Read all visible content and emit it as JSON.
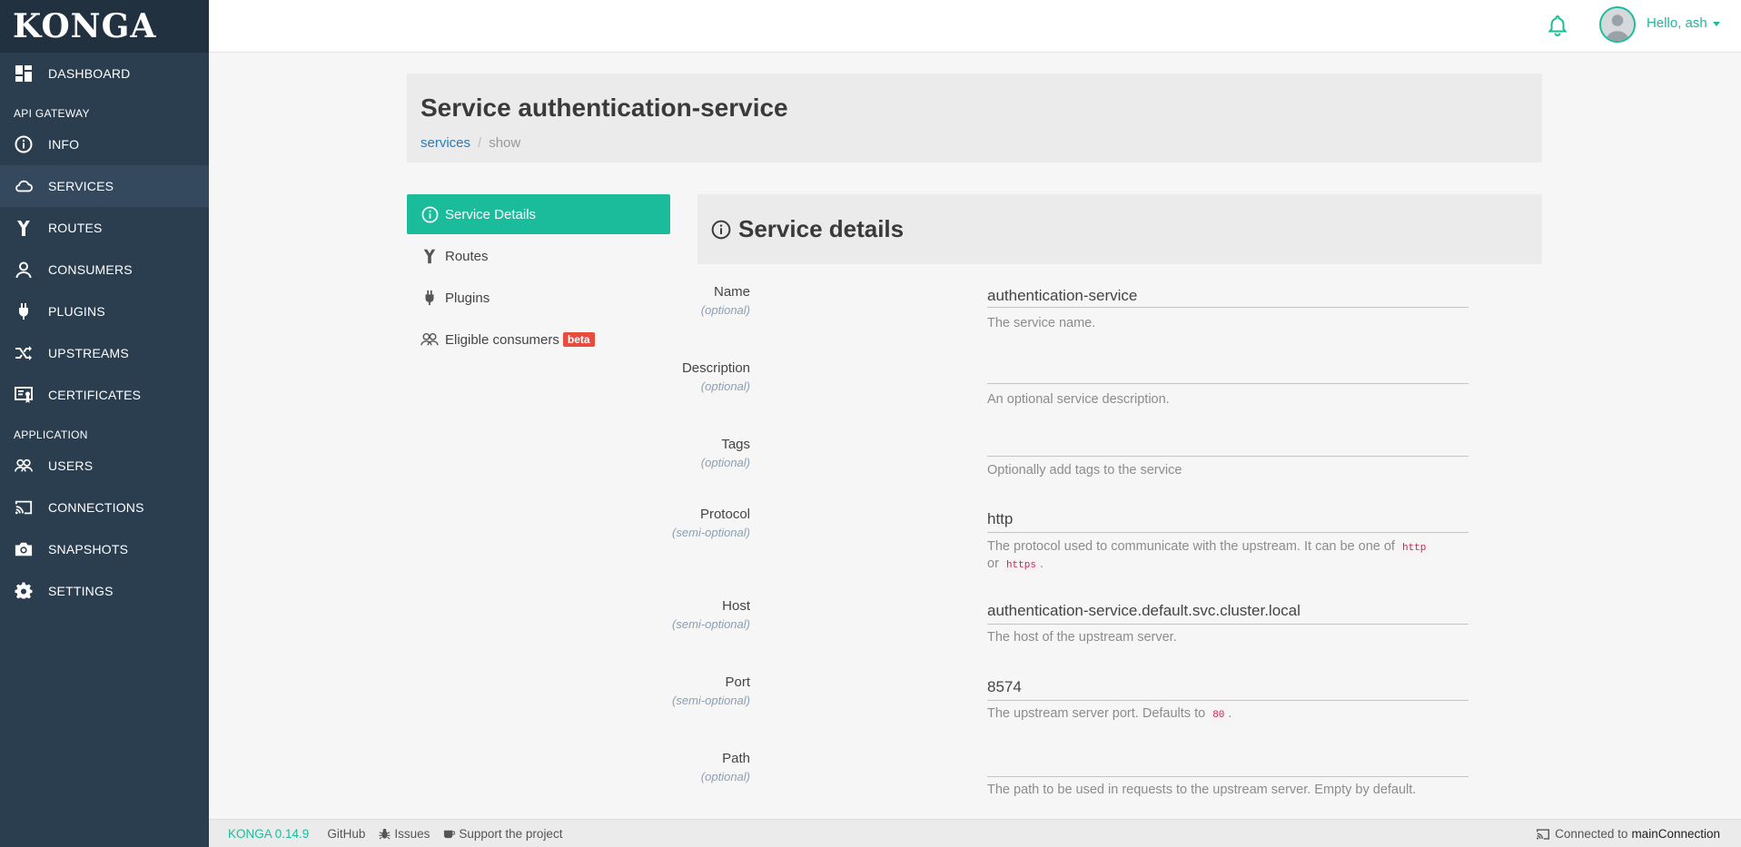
{
  "sidebar": {
    "logo": "KONGA",
    "sections": {
      "api_gateway": "API GATEWAY",
      "application": "APPLICATION"
    },
    "items": {
      "dashboard": "DASHBOARD",
      "info": "INFO",
      "services": "SERVICES",
      "routes": "ROUTES",
      "consumers": "CONSUMERS",
      "plugins": "PLUGINS",
      "upstreams": "UPSTREAMS",
      "certificates": "CERTIFICATES",
      "users": "USERS",
      "connections": "CONNECTIONS",
      "snapshots": "SNAPSHOTS",
      "settings": "SETTINGS"
    },
    "active_item": "services"
  },
  "topbar": {
    "user_label": "Hello, ash",
    "icons": [
      "bell-icon",
      "user-avatar"
    ]
  },
  "page": {
    "title": "Service authentication-service",
    "breadcrumb": {
      "link": "services",
      "separator": "/",
      "current": "show"
    }
  },
  "submenu": {
    "service_details": "Service Details",
    "routes": "Routes",
    "plugins": "Plugins",
    "eligible_consumers": "Eligible consumers",
    "beta": "beta",
    "active": "service_details"
  },
  "details": {
    "title": "Service details",
    "fields": {
      "name": {
        "label": "Name",
        "sub": "(optional)",
        "value": "authentication-service",
        "help": "The service name."
      },
      "description": {
        "label": "Description",
        "sub": "(optional)",
        "value": "",
        "help": "An optional service description."
      },
      "tags": {
        "label": "Tags",
        "sub": "(optional)",
        "value": "",
        "help": "Optionally add tags to the service"
      },
      "protocol": {
        "label": "Protocol",
        "sub": "(semi-optional)",
        "value": "http",
        "help_prefix": "The protocol used to communicate with the upstream. It can be one of",
        "code_1": "http",
        "help_or": "or",
        "code_2": "https",
        "help_suffix": "."
      },
      "host": {
        "label": "Host",
        "sub": "(semi-optional)",
        "value": "authentication-service.default.svc.cluster.local",
        "help": "The host of the upstream server."
      },
      "port": {
        "label": "Port",
        "sub": "(semi-optional)",
        "value": "8574",
        "help_prefix": "The upstream server port. Defaults to",
        "code": "80",
        "help_suffix": "."
      },
      "path": {
        "label": "Path",
        "sub": "(optional)",
        "value": "",
        "help": "The path to be used in requests to the upstream server. Empty by default."
      }
    }
  },
  "footer": {
    "version": "KONGA 0.14.9",
    "github": "GitHub",
    "issues": "Issues",
    "support": "Support the project",
    "connected_prefix": "Connected to",
    "connection_name": "mainConnection"
  },
  "colors": {
    "sidebar_bg": "#2b3e50",
    "sidebar_active": "#34495e",
    "accent": "#1abc9c",
    "beta_badge": "#e74c3c",
    "link": "#2a7bb8"
  }
}
